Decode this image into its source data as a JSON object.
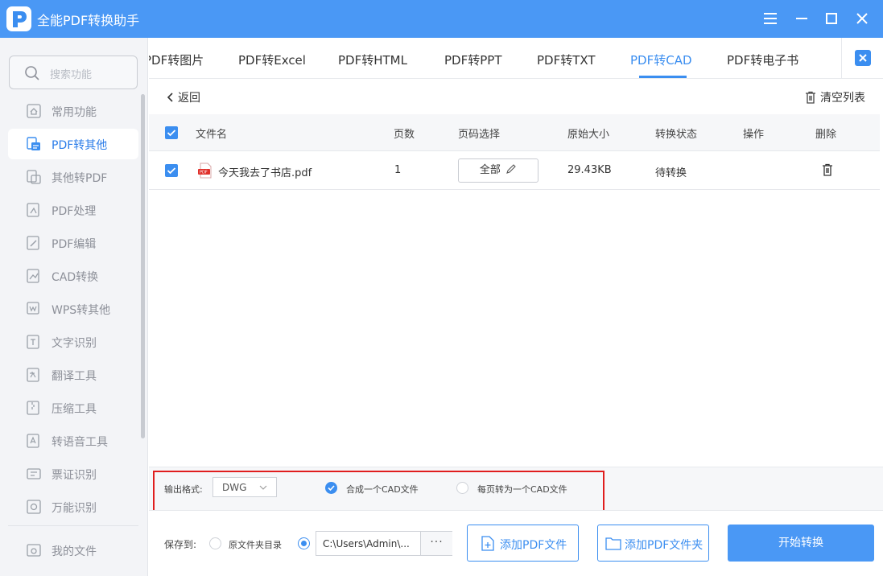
{
  "app": {
    "title": "全能PDF转换助手"
  },
  "sidebar": {
    "search_placeholder": "搜索功能",
    "items": [
      {
        "label": "常用功能"
      },
      {
        "label": "PDF转其他"
      },
      {
        "label": "其他转PDF"
      },
      {
        "label": "PDF处理"
      },
      {
        "label": "PDF编辑"
      },
      {
        "label": "CAD转换"
      },
      {
        "label": "WPS转其他"
      },
      {
        "label": "文字识别"
      },
      {
        "label": "翻译工具"
      },
      {
        "label": "压缩工具"
      },
      {
        "label": "转语音工具"
      },
      {
        "label": "票证识别"
      },
      {
        "label": "万能识别"
      },
      {
        "label": "我的文件"
      }
    ]
  },
  "tabs": [
    {
      "label": "PDF转图片"
    },
    {
      "label": "PDF转Excel"
    },
    {
      "label": "PDF转HTML"
    },
    {
      "label": "PDF转PPT"
    },
    {
      "label": "PDF转TXT"
    },
    {
      "label": "PDF转CAD"
    },
    {
      "label": "PDF转电子书"
    }
  ],
  "toolbar": {
    "back_label": "返回",
    "clear_label": "清空列表"
  },
  "table": {
    "headers": {
      "name": "文件名",
      "pages": "页数",
      "page_select": "页码选择",
      "size": "原始大小",
      "status": "转换状态",
      "action": "操作",
      "delete": "删除"
    },
    "rows": [
      {
        "name": "今天我去了书店.pdf",
        "pages": "1",
        "page_select": "全部",
        "size": "29.43KB",
        "status": "待转换",
        "checked": true
      }
    ]
  },
  "options": {
    "format_label": "输出格式:",
    "format_value": "DWG",
    "merge_label": "合成一个CAD文件",
    "per_page_label": "每页转为一个CAD文件"
  },
  "save": {
    "label": "保存到:",
    "original_dir_label": "原文件夹目录",
    "path_value": "C:\\Users\\Admin\\...",
    "more_label": "···"
  },
  "buttons": {
    "add_file": "添加PDF文件",
    "add_folder": "添加PDF文件夹",
    "start": "开始转换"
  },
  "colors": {
    "accent": "#3b8ef0",
    "titlebar": "#4a98f5",
    "highlight_frame": "#e01e1e"
  }
}
